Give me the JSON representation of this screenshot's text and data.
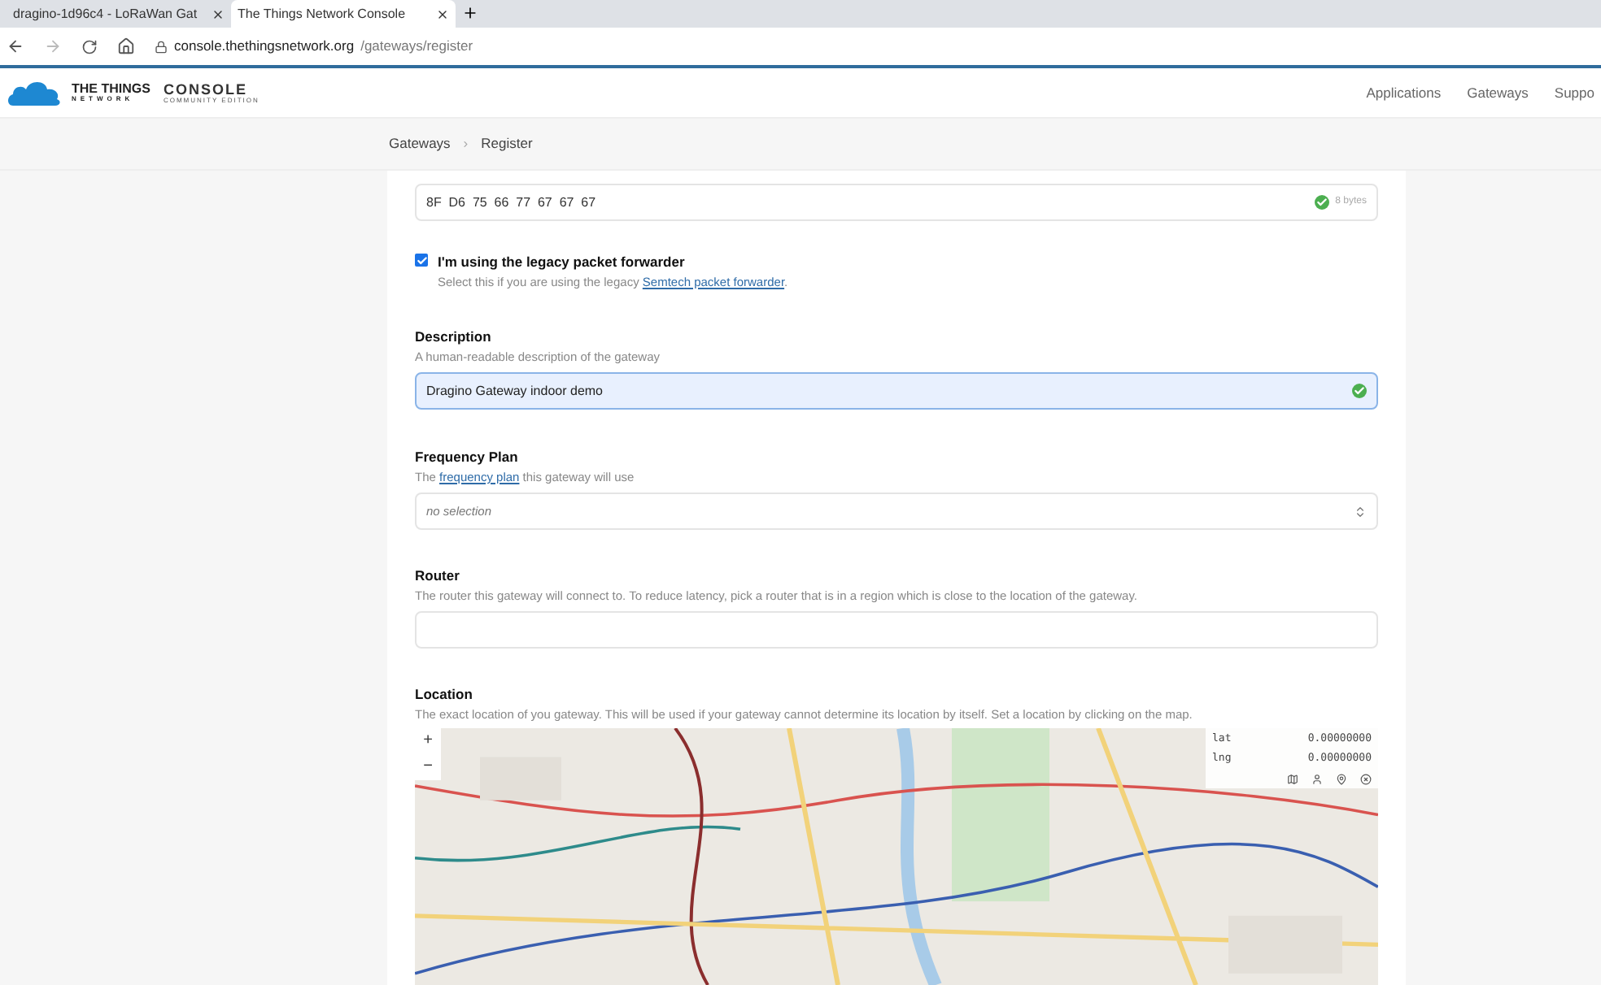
{
  "browser": {
    "tabs": [
      {
        "title": "dragino-1d96c4 - LoRaWan Gat",
        "selected": false
      },
      {
        "title": "The Things Network Console",
        "selected": true
      }
    ],
    "address": {
      "domain": "console.thethingsnetwork.org",
      "path": "/gateways/register"
    }
  },
  "header": {
    "logo": {
      "line1": "THE THINGS",
      "line2": "NETWORK",
      "product": "CONSOLE",
      "edition": "COMMUNITY EDITION"
    },
    "nav": [
      "Applications",
      "Gateways",
      "Suppo"
    ]
  },
  "breadcrumb": {
    "separator": "›",
    "items": [
      "Gateways",
      "Register"
    ]
  },
  "eui_field": {
    "value": "8F  D6  75  66  77  67  67  67",
    "hint": "8 bytes",
    "valid": true
  },
  "legacy": {
    "checked": true,
    "label": "I'm using the legacy packet forwarder",
    "help": "Select this if you are using the legacy ",
    "link": "Semtech packet forwarder",
    "help_end": "."
  },
  "description": {
    "label": "Description",
    "help": "A human-readable description of the gateway",
    "value": "Dragino Gateway indoor demo",
    "valid": true,
    "focused": true
  },
  "frequency_plan": {
    "label": "Frequency Plan",
    "help_start": "The ",
    "link": "frequency plan",
    "help_end": " this gateway will use",
    "placeholder": "no selection"
  },
  "router": {
    "label": "Router",
    "help": "The router this gateway will connect to. To reduce latency, pick a router that is in a region which is close to the location of the gateway."
  },
  "location": {
    "label": "Location",
    "help": "The exact location of you gateway. This will be used if your gateway cannot determine its location by itself. Set a location by clicking on the map.",
    "map": {
      "kind": "picture",
      "zoom_in": "+",
      "zoom_out": "−",
      "lat_label": "lat",
      "lat": "0.00000000",
      "lng_label": "lng",
      "lng": "0.00000000"
    }
  }
}
